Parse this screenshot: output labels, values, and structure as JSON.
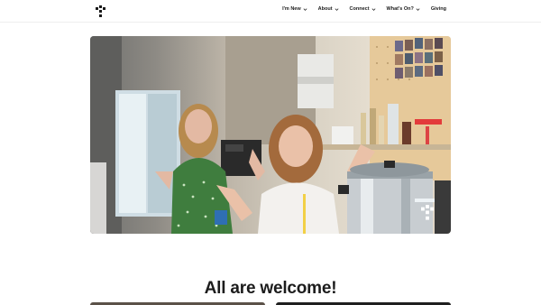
{
  "header": {
    "nav": [
      {
        "label": "I'm New",
        "has_dropdown": true
      },
      {
        "label": "About",
        "has_dropdown": true
      },
      {
        "label": "Connect",
        "has_dropdown": true
      },
      {
        "label": "What's On?",
        "has_dropdown": true
      },
      {
        "label": "Giving",
        "has_dropdown": false
      }
    ]
  },
  "hero": {
    "image_description": "two women smiling and waving in a cafe kitchen",
    "watermark_icon": "brand-logo-icon"
  },
  "main": {
    "heading": "All are welcome!"
  },
  "colors": {
    "text": "#1a1a1a",
    "background": "#ffffff"
  }
}
